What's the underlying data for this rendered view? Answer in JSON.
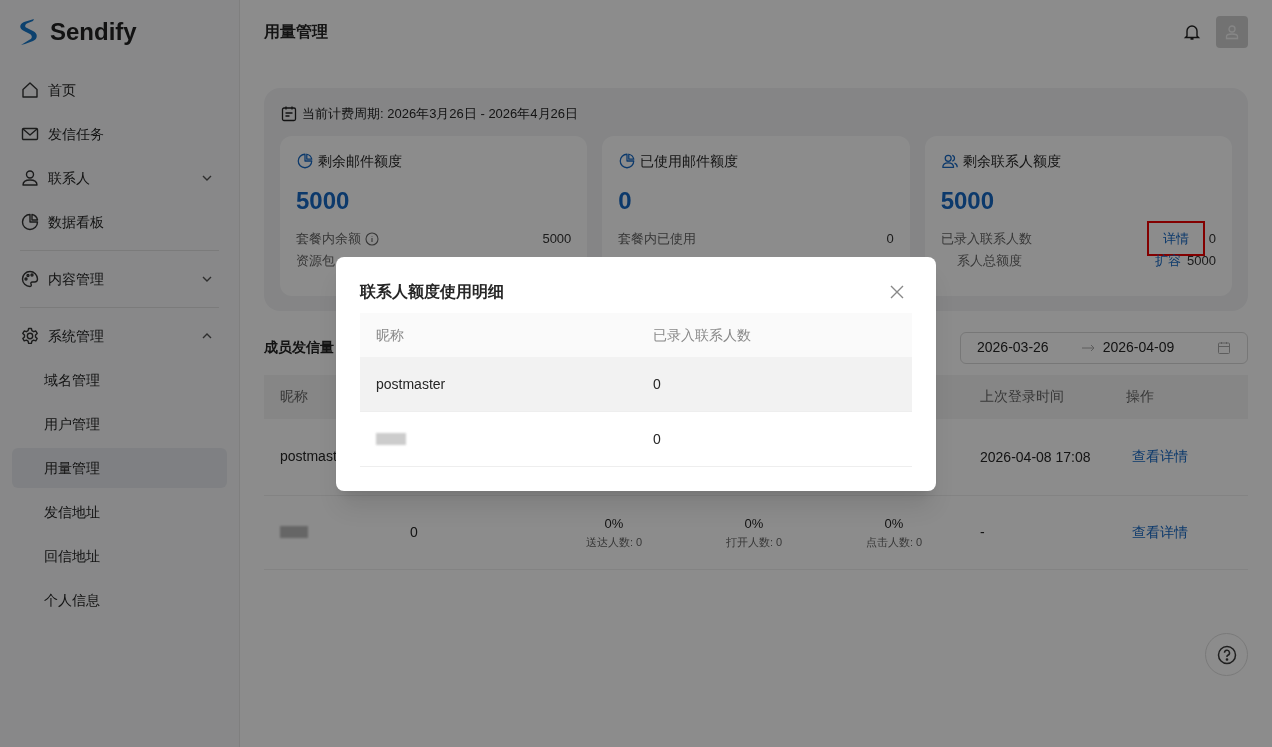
{
  "app": {
    "logo_text": "Sendify"
  },
  "sidebar": {
    "sections": [
      [
        {
          "label": "首页",
          "kind": "home"
        },
        {
          "label": "发信任务",
          "kind": "mail"
        },
        {
          "label": "联系人",
          "kind": "user",
          "expanded": false
        },
        {
          "label": "数据看板",
          "kind": "pie"
        }
      ],
      [
        {
          "label": "内容管理",
          "kind": "palette",
          "expanded": false
        }
      ],
      [
        {
          "label": "系统管理",
          "kind": "gear",
          "expanded": true,
          "children": [
            {
              "label": "域名管理",
              "selected": false
            },
            {
              "label": "用户管理",
              "selected": false
            },
            {
              "label": "用量管理",
              "selected": true
            },
            {
              "label": "发信地址",
              "selected": false
            },
            {
              "label": "回信地址",
              "selected": false
            },
            {
              "label": "个人信息",
              "selected": false
            }
          ]
        }
      ]
    ]
  },
  "header": {
    "title": "用量管理"
  },
  "quota": {
    "period_label": "当前计费周期: 2026年3月26日 - 2026年4月26日",
    "cards": [
      {
        "kind": "pie",
        "title": "剩余邮件额度",
        "value": "5000",
        "rows": [
          {
            "label": "套餐内余额",
            "info": true,
            "value": "5000"
          },
          {
            "label": "资源包"
          }
        ]
      },
      {
        "kind": "pie",
        "title": "已使用邮件额度",
        "value": "0",
        "rows": [
          {
            "label": "套餐内已使用",
            "value": "0"
          }
        ]
      },
      {
        "kind": "users",
        "title": "剩余联系人额度",
        "value": "5000",
        "rows": [
          {
            "label": "已录入联系人数",
            "link": "详情",
            "highlighted": true,
            "value": "0"
          },
          {
            "label": "系人总额度",
            "clipped_left": true,
            "link": "扩容",
            "highlighted": false,
            "value": "5000"
          }
        ]
      }
    ]
  },
  "members": {
    "title": "成员发信量",
    "date_range": {
      "start": "2026-03-26",
      "end": "2026-04-09"
    },
    "columns": {
      "nickname": "昵称",
      "last_login": "上次登录时间",
      "action": "操作"
    },
    "rows": [
      {
        "nickname": "postmast",
        "last_login": "2026-04-08 17:08",
        "action": "查看详情"
      },
      {
        "redacted": true,
        "count": "0",
        "stats": [
          {
            "pct": "0%",
            "label": "送达人数: 0"
          },
          {
            "pct": "0%",
            "label": "打开人数: 0"
          },
          {
            "pct": "0%",
            "label": "点击人数: 0"
          }
        ],
        "last_login": "-",
        "action": "查看详情"
      }
    ]
  },
  "modal": {
    "title": "联系人额度使用明细",
    "columns": [
      "昵称",
      "已录入联系人数"
    ],
    "rows": [
      {
        "nickname": "postmaster",
        "count": "0",
        "hovered": true
      },
      {
        "redacted": true,
        "count": "0",
        "hovered": false
      }
    ]
  }
}
